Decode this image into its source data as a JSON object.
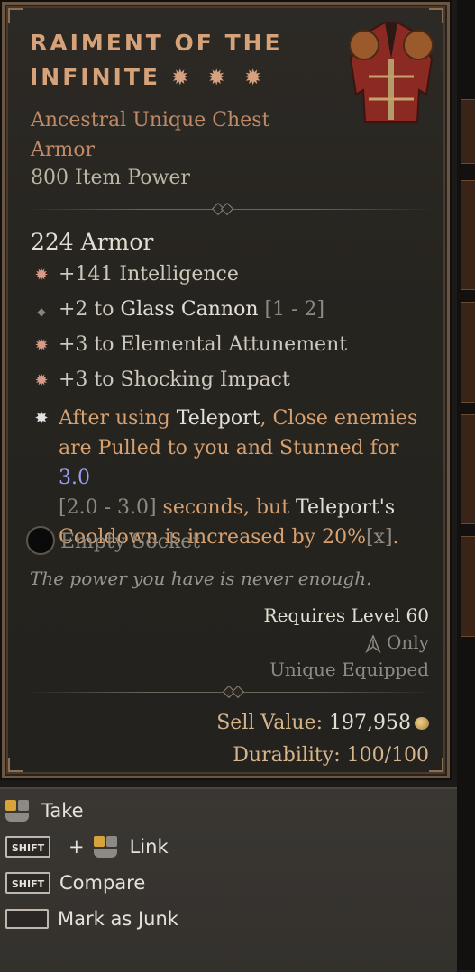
{
  "item": {
    "name_line1": "RAIMENT OF THE",
    "name_line2": "INFINITE",
    "stars": "✹ ✹ ✹",
    "rarity_type_line1": "Ancestral Unique Chest",
    "rarity_type_line2": "Armor",
    "item_power": "800 Item Power",
    "armor": "224 Armor",
    "affixes": [
      {
        "text": "+141 Intelligence",
        "range": ""
      },
      {
        "text_pre": "+2 to ",
        "text_hl": "Glass Cannon",
        "range": "[1 - 2]"
      },
      {
        "text": "+3 to Elemental Attunement",
        "range": ""
      },
      {
        "text": "+3 to Shocking Impact",
        "range": ""
      }
    ],
    "unique_power": {
      "p1": "After using ",
      "p2": "Teleport",
      "p3": ", Close enemies are Pulled to you and Stunned for ",
      "p4": "3.0",
      "p5": "[2.0 - 3.0]",
      "p6": " seconds, but ",
      "p7": "Teleport's",
      "p8": " Cooldown is increased by 20%",
      "p9": "[x]",
      "p10": "."
    },
    "socket": "Empty Socket",
    "flavor": "The power you have is never enough.",
    "requires_level": "Requires Level 60",
    "class_only": "Only",
    "unique_equipped": "Unique Equipped",
    "sell_label": "Sell Value: ",
    "sell_value": "197,958",
    "durability": "Durability: 100/100"
  },
  "actions": {
    "take": "Take",
    "link": "Link",
    "compare": "Compare",
    "junk": "Mark as Junk",
    "shift_key": "SHIFT",
    "plus": "+"
  },
  "colors": {
    "unique_text": "#d6a070",
    "title": "#d5a27a",
    "highlight_blue": "#9a9cf5"
  }
}
